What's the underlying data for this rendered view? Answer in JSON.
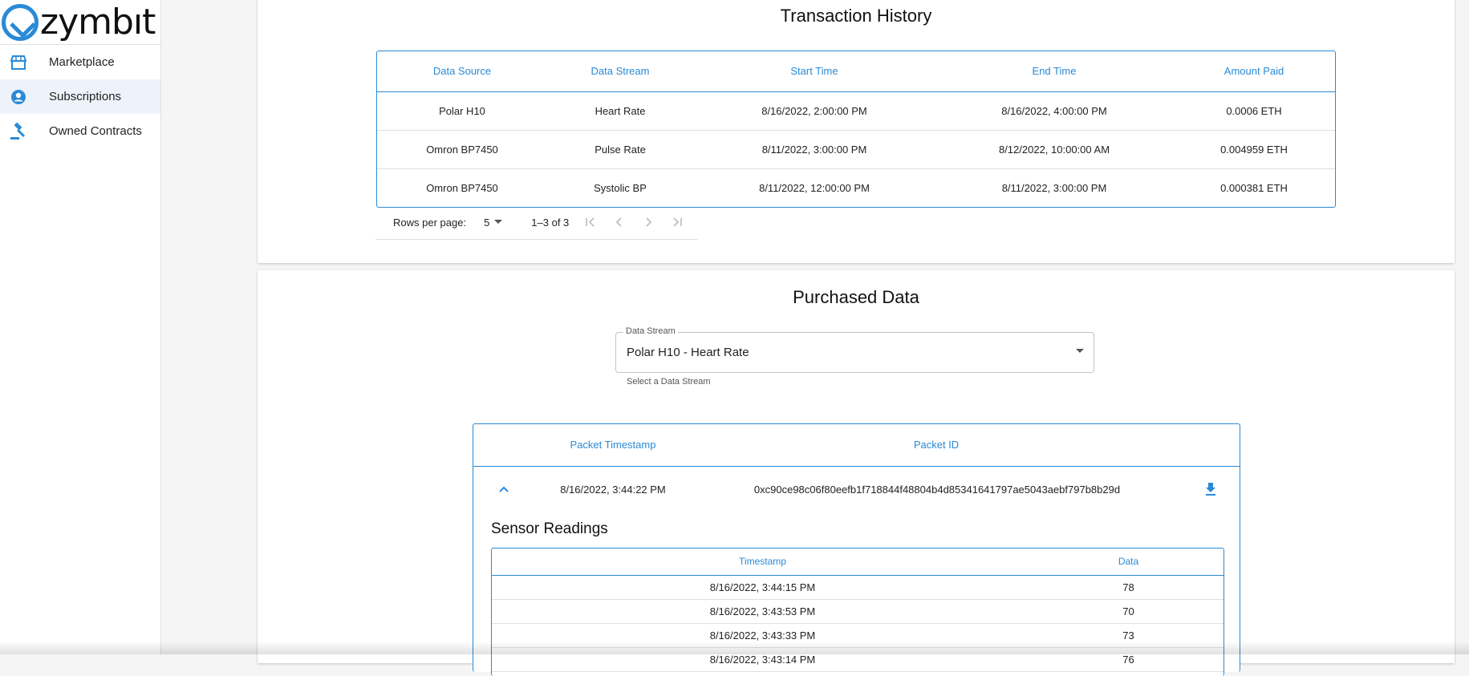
{
  "sidebar": {
    "logo_text": "zymbıt",
    "items": [
      {
        "label": "Marketplace",
        "icon": "storefront-icon"
      },
      {
        "label": "Subscriptions",
        "icon": "account-circle-icon"
      },
      {
        "label": "Owned Contracts",
        "icon": "gavel-icon"
      }
    ]
  },
  "transaction_history": {
    "title": "Transaction History",
    "columns": [
      "Data Source",
      "Data Stream",
      "Start Time",
      "End Time",
      "Amount Paid"
    ],
    "rows": [
      [
        "Polar H10",
        "Heart Rate",
        "8/16/2022, 2:00:00 PM",
        "8/16/2022, 4:00:00 PM",
        "0.0006 ETH"
      ],
      [
        "Omron BP7450",
        "Pulse Rate",
        "8/11/2022, 3:00:00 PM",
        "8/12/2022, 10:00:00 AM",
        "0.004959 ETH"
      ],
      [
        "Omron BP7450",
        "Systolic BP",
        "8/11/2022, 12:00:00 PM",
        "8/11/2022, 3:00:00 PM",
        "0.000381 ETH"
      ]
    ],
    "pagination": {
      "rows_per_page_label": "Rows per page:",
      "rows_per_page": "5",
      "range": "1–3 of 3"
    }
  },
  "purchased_data": {
    "title": "Purchased Data",
    "select": {
      "label": "Data Stream",
      "value": "Polar H10 - Heart Rate",
      "helper": "Select a Data Stream"
    },
    "packet_columns": [
      "Packet Timestamp",
      "Packet ID"
    ],
    "packet": {
      "timestamp": "8/16/2022, 3:44:22 PM",
      "id": "0xc90ce98c06f80eefb1f718844f48804b4d85341641797ae5043aebf797b8b29d"
    },
    "sensor_readings": {
      "title": "Sensor Readings",
      "columns": [
        "Timestamp",
        "Data"
      ],
      "rows": [
        [
          "8/16/2022, 3:44:15 PM",
          "78"
        ],
        [
          "8/16/2022, 3:43:53 PM",
          "70"
        ],
        [
          "8/16/2022, 3:43:33 PM",
          "73"
        ],
        [
          "8/16/2022, 3:43:14 PM",
          "76"
        ]
      ]
    }
  },
  "colors": {
    "accent": "#2a8ad6",
    "active_nav_bg": "#eef3fb"
  }
}
